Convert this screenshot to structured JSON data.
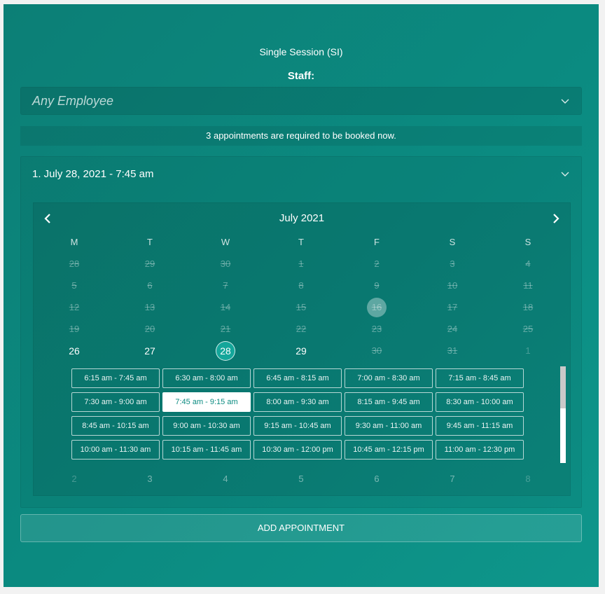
{
  "form": {
    "service_title": "Single Session (SI)",
    "staff_label": "Staff:",
    "staff_value": "Any Employee",
    "notice": "3 appointments are required to be booked now.",
    "appointment_header": "1. July 28, 2021 - 7:45 am",
    "add_button": "ADD APPOINTMENT"
  },
  "calendar": {
    "month_label": "July 2021",
    "weekdays": [
      "M",
      "T",
      "W",
      "T",
      "F",
      "S",
      "S"
    ],
    "weeks": [
      [
        {
          "d": "28",
          "s": "dis"
        },
        {
          "d": "29",
          "s": "dis"
        },
        {
          "d": "30",
          "s": "dis"
        },
        {
          "d": "1",
          "s": "dis"
        },
        {
          "d": "2",
          "s": "dis"
        },
        {
          "d": "3",
          "s": "dis"
        },
        {
          "d": "4",
          "s": "dis"
        }
      ],
      [
        {
          "d": "5",
          "s": "dis"
        },
        {
          "d": "6",
          "s": "dis"
        },
        {
          "d": "7",
          "s": "dis"
        },
        {
          "d": "8",
          "s": "dis"
        },
        {
          "d": "9",
          "s": "dis"
        },
        {
          "d": "10",
          "s": "dis"
        },
        {
          "d": "11",
          "s": "dis"
        }
      ],
      [
        {
          "d": "12",
          "s": "dis"
        },
        {
          "d": "13",
          "s": "dis"
        },
        {
          "d": "14",
          "s": "dis"
        },
        {
          "d": "15",
          "s": "dis"
        },
        {
          "d": "16",
          "s": "today"
        },
        {
          "d": "17",
          "s": "dis"
        },
        {
          "d": "18",
          "s": "dis"
        }
      ],
      [
        {
          "d": "19",
          "s": "dis"
        },
        {
          "d": "20",
          "s": "dis"
        },
        {
          "d": "21",
          "s": "dis"
        },
        {
          "d": "22",
          "s": "dis"
        },
        {
          "d": "23",
          "s": "dis"
        },
        {
          "d": "24",
          "s": "dis"
        },
        {
          "d": "25",
          "s": "dis"
        }
      ],
      [
        {
          "d": "26",
          "s": "act"
        },
        {
          "d": "27",
          "s": "act"
        },
        {
          "d": "28",
          "s": "sel"
        },
        {
          "d": "29",
          "s": "act"
        },
        {
          "d": "30",
          "s": "dis"
        },
        {
          "d": "31",
          "s": "dis"
        },
        {
          "d": "1",
          "s": "ghost"
        }
      ],
      [
        {
          "d": "2",
          "s": "ghost"
        },
        {
          "d": "3",
          "s": "dim"
        },
        {
          "d": "4",
          "s": "dim"
        },
        {
          "d": "5",
          "s": "dim"
        },
        {
          "d": "6",
          "s": "dim"
        },
        {
          "d": "7",
          "s": "dim"
        },
        {
          "d": "8",
          "s": "ghost"
        }
      ]
    ],
    "time_slots": [
      "6:15 am - 7:45 am",
      "6:30 am - 8:00 am",
      "6:45 am - 8:15 am",
      "7:00 am - 8:30 am",
      "7:15 am - 8:45 am",
      "7:30 am - 9:00 am",
      "7:45 am - 9:15 am",
      "8:00 am - 9:30 am",
      "8:15 am - 9:45 am",
      "8:30 am - 10:00 am",
      "8:45 am - 10:15 am",
      "9:00 am - 10:30 am",
      "9:15 am - 10:45 am",
      "9:30 am - 11:00 am",
      "9:45 am - 11:15 am",
      "10:00 am - 11:30 am",
      "10:15 am - 11:45 am",
      "10:30 am - 12:00 pm",
      "10:45 am - 12:15 pm",
      "11:00 am - 12:30 pm"
    ],
    "selected_slot": "7:45 am - 9:15 am"
  },
  "icons": {
    "staff_dropdown": "chevron-down-icon",
    "appointment_toggle": "chevron-down-icon",
    "prev_month": "chevron-left-icon",
    "next_month": "chevron-right-icon"
  },
  "colors": {
    "panel_bg": "#0b8b81",
    "selected_day": "#14a69a",
    "selected_slot_bg": "#ffffff"
  }
}
